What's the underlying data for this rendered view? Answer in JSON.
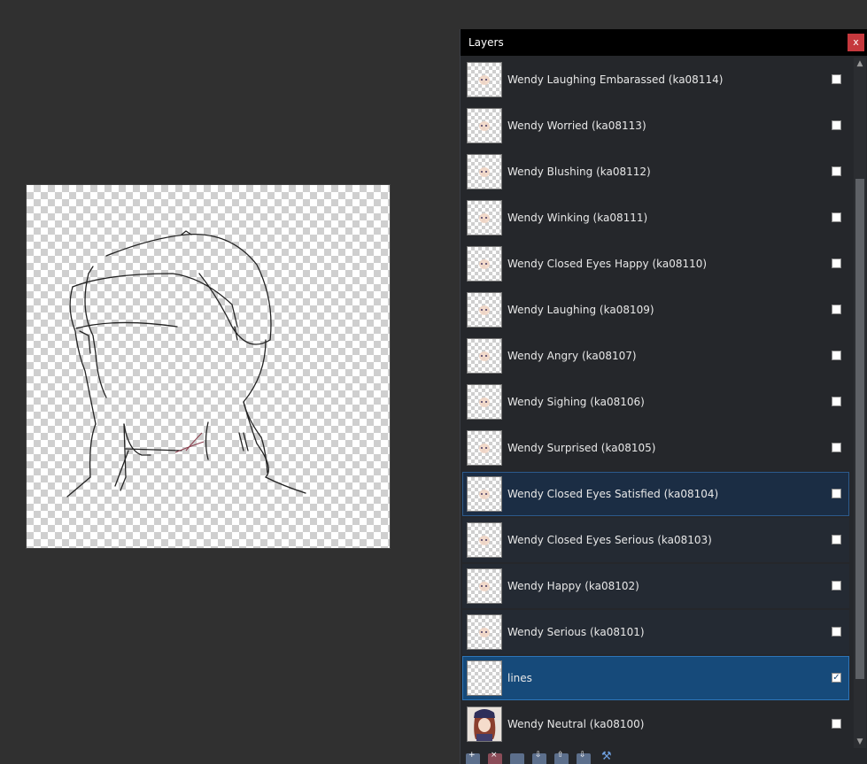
{
  "panel": {
    "title": "Layers",
    "close_label": "x"
  },
  "layers": [
    {
      "name": "Wendy Laughing Embarassed (ka08114)",
      "visible": false,
      "state": "normal"
    },
    {
      "name": "Wendy Worried (ka08113)",
      "visible": false,
      "state": "normal"
    },
    {
      "name": "Wendy Blushing (ka08112)",
      "visible": false,
      "state": "normal"
    },
    {
      "name": "Wendy Winking (ka08111)",
      "visible": false,
      "state": "normal"
    },
    {
      "name": "Wendy Closed Eyes Happy (ka08110)",
      "visible": false,
      "state": "normal"
    },
    {
      "name": "Wendy Laughing (ka08109)",
      "visible": false,
      "state": "normal"
    },
    {
      "name": "Wendy Angry (ka08107)",
      "visible": false,
      "state": "normal"
    },
    {
      "name": "Wendy Sighing (ka08106)",
      "visible": false,
      "state": "normal"
    },
    {
      "name": "Wendy Surprised (ka08105)",
      "visible": false,
      "state": "normal"
    },
    {
      "name": "Wendy Closed Eyes Satisfied (ka08104)",
      "visible": false,
      "state": "dim"
    },
    {
      "name": "Wendy Closed Eyes Serious (ka08103)",
      "visible": false,
      "state": "faint"
    },
    {
      "name": "Wendy Happy (ka08102)",
      "visible": false,
      "state": "faint"
    },
    {
      "name": "Wendy Serious (ka08101)",
      "visible": false,
      "state": "faint"
    },
    {
      "name": "lines",
      "visible": true,
      "state": "active"
    },
    {
      "name": "Wendy Neutral (ka08100)",
      "visible": false,
      "state": "normal"
    }
  ],
  "scroll": {
    "up_icon": "chevron-up-icon",
    "down_icon": "chevron-down-icon",
    "position": 0.18
  },
  "toolbar": {
    "icons": [
      "add-layer-icon",
      "delete-layer-icon",
      "duplicate-layer-icon",
      "merge-down-icon",
      "move-up-icon",
      "move-down-icon",
      "properties-icon"
    ]
  },
  "colors": {
    "active_row": "#164a7a",
    "close_button": "#c5383d"
  }
}
